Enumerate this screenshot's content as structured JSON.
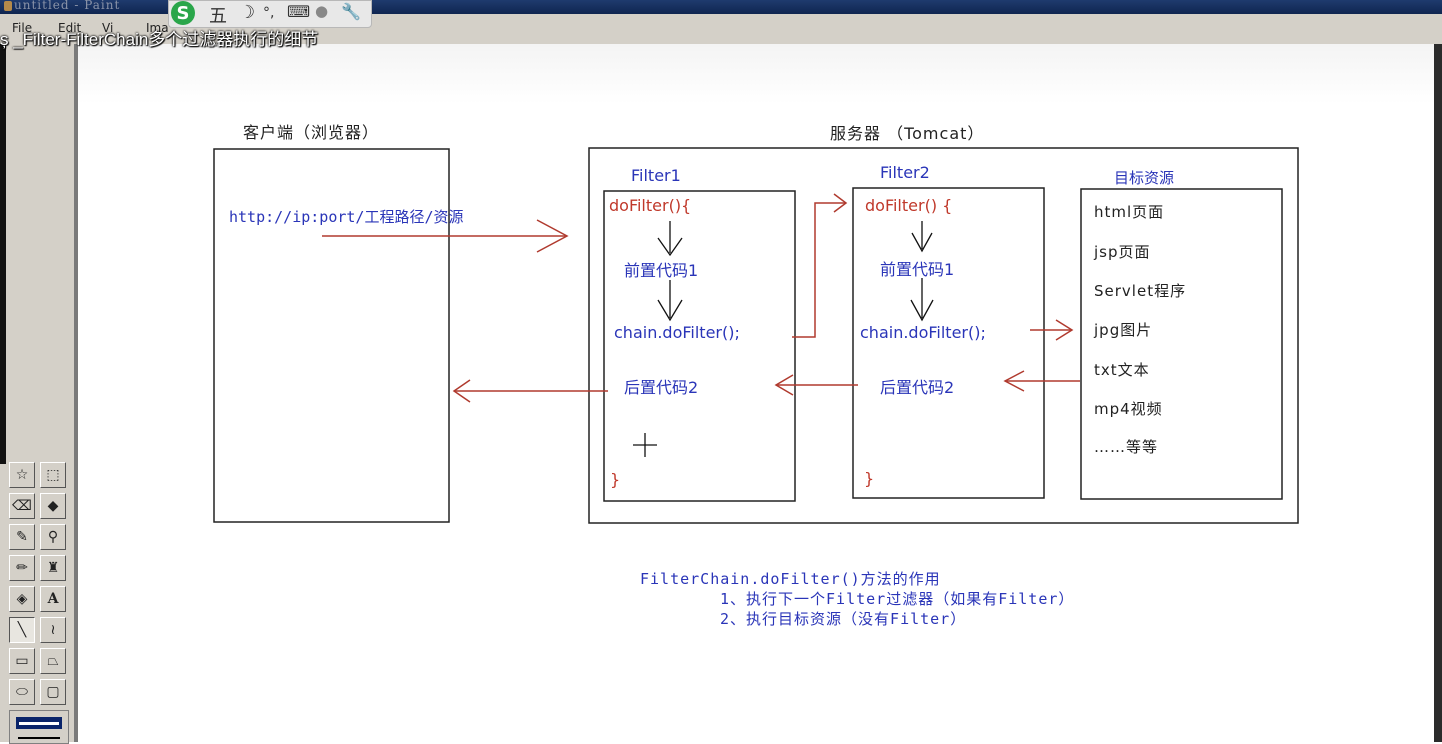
{
  "window": {
    "title": "untitled - Paint",
    "video_title": "ș _Filter-FilterChain多个过滤器执行的细节",
    "ime_logo": "S",
    "ime_mode": "五",
    "menus": [
      "File",
      "Edit",
      "Vi",
      "Ima"
    ]
  },
  "toolbox": {
    "tools": [
      "free-form-select",
      "select",
      "eraser",
      "fill",
      "pick-color",
      "magnifier",
      "pencil",
      "brush",
      "airbrush",
      "text",
      "line",
      "curve",
      "rectangle",
      "polygon",
      "ellipse",
      "rounded-rectangle"
    ],
    "selected_tool": "line",
    "text_tool_glyph": "A"
  },
  "diagram": {
    "client": {
      "heading": "客户端（浏览器）",
      "url": "http://ip:port/工程路径/资源"
    },
    "server": {
      "heading": "服务器  （Tomcat）",
      "filter1": {
        "name": "Filter1",
        "open": "doFilter(){",
        "pre": "前置代码1",
        "chain": "chain.doFilter();",
        "post": "后置代码2",
        "close": "}"
      },
      "filter2": {
        "name": "Filter2",
        "open": "doFilter() {",
        "pre": "前置代码1",
        "chain": "chain.doFilter();",
        "post": "后置代码2",
        "close": "}"
      },
      "resources": {
        "heading": "目标资源",
        "items": [
          "html页面",
          "jsp页面",
          "Servlet程序",
          "jpg图片",
          "txt文本",
          "mp4视频",
          "……等等"
        ]
      }
    },
    "notes": {
      "title": "FilterChain.doFilter()方法的作用",
      "line1": "1、执行下一个Filter过滤器（如果有Filter）",
      "line2": "2、执行目标资源（没有Filter）"
    }
  },
  "colors": {
    "blue_text": "#2a35b8",
    "red_text": "#c0392b",
    "arrow": "#b03a2e"
  }
}
